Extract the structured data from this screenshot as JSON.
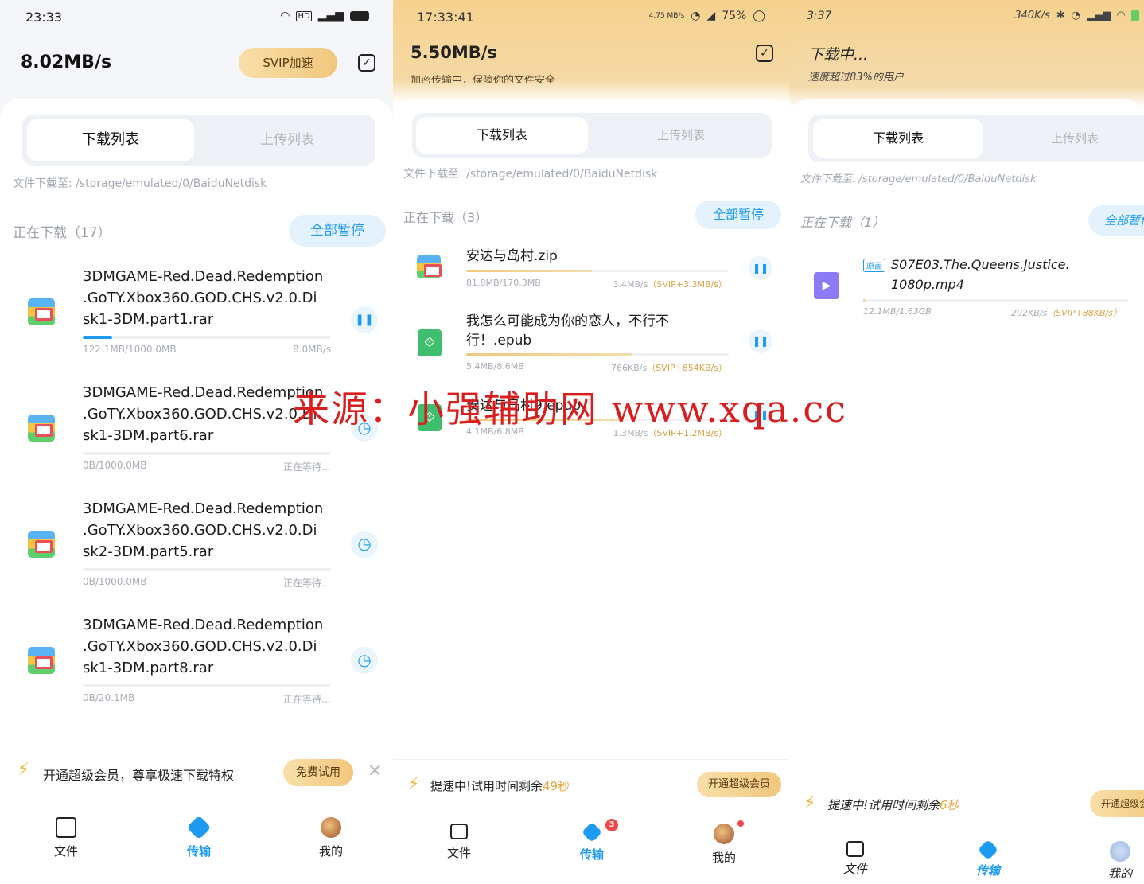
{
  "panel1": {
    "status_time": "23:33",
    "status_icons": [
      "wifi-icon",
      "hd-icon",
      "signal-icon",
      "battery-icon"
    ],
    "speed": "8.02MB/s",
    "svip_button": "SVIP加速",
    "tabs": [
      "下载列表",
      "上传列表"
    ],
    "path": "文件下载至: /storage/emulated/0/BaiduNetdisk",
    "section": "正在下载（17）",
    "pause_all": "全部暂停",
    "items": [
      {
        "name": "3DMGAME-Red.Dead.Redemption\n.GoTY.Xbox360.GOD.CHS.v2.0.Di\nsk1-3DM.part1.rar",
        "size": "122.1MB/1000.0MB",
        "status": "8.0MB/s",
        "progress": 0.12,
        "action": "pause"
      },
      {
        "name": "3DMGAME-Red.Dead.Redemption\n.GoTY.Xbox360.GOD.CHS.v2.0.Di\nsk1-3DM.part6.rar",
        "size": "0B/1000.0MB",
        "status": "正在等待…",
        "progress": 0,
        "action": "waiting"
      },
      {
        "name": "3DMGAME-Red.Dead.Redemption\n.GoTY.Xbox360.GOD.CHS.v2.0.Di\nsk2-3DM.part5.rar",
        "size": "0B/1000.0MB",
        "status": "正在等待…",
        "progress": 0,
        "action": "waiting"
      },
      {
        "name": "3DMGAME-Red.Dead.Redemption\n.GoTY.Xbox360.GOD.CHS.v2.0.Di\nsk1-3DM.part8.rar",
        "size": "0B/20.1MB",
        "status": "正在等待…",
        "progress": 0,
        "action": "waiting"
      }
    ],
    "promo": "开通超级会员，尊享极速下载特权",
    "promo_button": "免费试用",
    "nav": [
      "文件",
      "传输",
      "我的"
    ]
  },
  "panel2": {
    "status_time": "17:33:41",
    "status_net": "4.75 MB/s",
    "status_battery": "75%",
    "speed": "5.50MB/s",
    "subtitle": "加密传输中，保障你的文件安全",
    "tabs": [
      "下载列表",
      "上传列表"
    ],
    "path": "文件下载至: /storage/emulated/0/BaiduNetdisk",
    "section": "正在下载（3）",
    "pause_all": "全部暂停",
    "items": [
      {
        "name": "安达与岛村.zip",
        "size": "81.8MB/170.3MB",
        "speed": "3.4MB/s",
        "vip": "（SVIP+3.3MB/s）",
        "progress": 0.48,
        "type": "zip"
      },
      {
        "name": "我怎么可能成为你的恋人，不行不\n行！.epub",
        "size": "5.4MB/8.6MB",
        "speed": "766KB/s",
        "vip": "（SVIP+654KB/s）",
        "progress": 0.63,
        "type": "epub"
      },
      {
        "name": "安达与岛村9.epub",
        "size": "4.1MB/6.8MB",
        "speed": "1.3MB/s",
        "vip": "（SVIP+1.2MB/s）",
        "progress": 0.6,
        "type": "epub"
      }
    ],
    "promo": "提速中!试用时间剩余",
    "promo_time": "49秒",
    "promo_button": "开通超级会员",
    "nav": [
      "文件",
      "传输",
      "我的"
    ],
    "nav_badge": "3"
  },
  "panel3": {
    "status_time": "3:37",
    "status_net": "340K/s",
    "title": "下载中...",
    "subtitle": "速度超过83%的用户",
    "tabs": [
      "下载列表",
      "上传列表"
    ],
    "path": "文件下载至: /storage/emulated/0/BaiduNetdisk",
    "section": "正在下载（1）",
    "pause_all": "全部暂停",
    "item": {
      "tag": "原画",
      "name": "S07E03.The.Queens.Justice.\n1080p.mp4",
      "size": "12.1MB/1.63GB",
      "speed": "202KB/s",
      "vip": "（SVIP+88KB/s）",
      "progress": 0.01
    },
    "promo": "提速中!试用时间剩余",
    "promo_time": "6秒",
    "promo_button": "开通超级会员",
    "nav": [
      "文件",
      "传输",
      "我的"
    ]
  },
  "watermark": "来源：小强辅助网 www.xqa.cc",
  "colors": {
    "accent": "#1e9bf0",
    "gold": "#f1c77d",
    "vip_text": "#d8a243"
  }
}
